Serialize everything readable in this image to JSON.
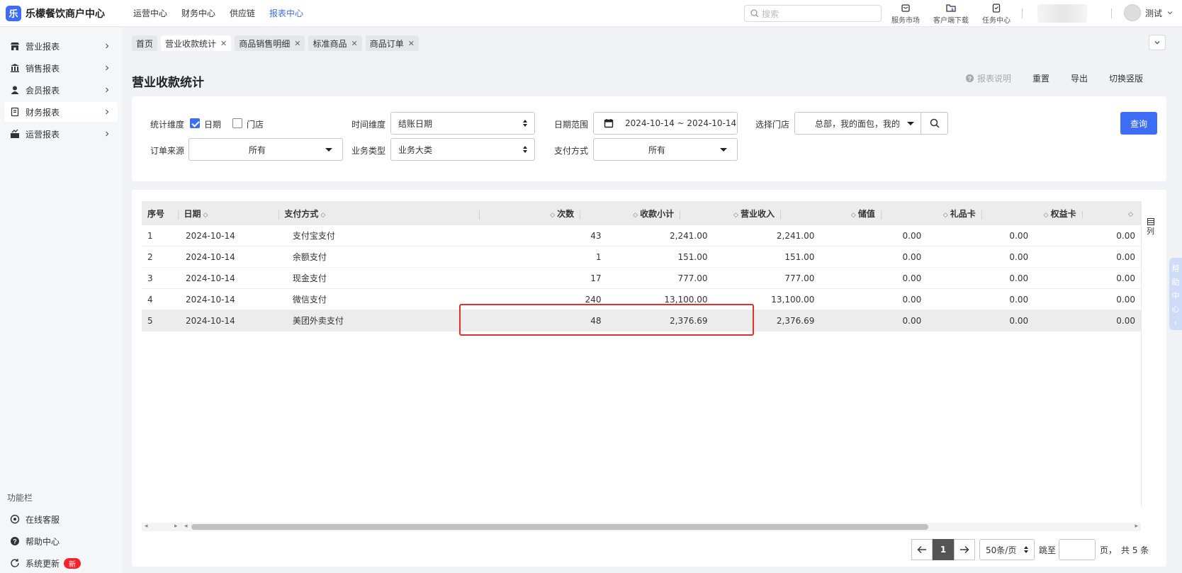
{
  "app": {
    "title": "乐檬餐饮商户中心",
    "logo_glyph": "乐"
  },
  "topnav": [
    {
      "label": "运营中心",
      "active": false
    },
    {
      "label": "财务中心",
      "active": false
    },
    {
      "label": "供应链",
      "active": false
    },
    {
      "label": "报表中心",
      "active": true
    }
  ],
  "search": {
    "placeholder": "搜索"
  },
  "tools": [
    {
      "label": "服务市场",
      "icon": "store-icon"
    },
    {
      "label": "客户端下载",
      "icon": "download-folder-icon"
    },
    {
      "label": "任务中心",
      "icon": "clipboard-icon"
    }
  ],
  "user": {
    "name": "测试"
  },
  "sidebar": {
    "items": [
      {
        "label": "营业报表",
        "icon": "shop-icon"
      },
      {
        "label": "销售报表",
        "icon": "bank-icon"
      },
      {
        "label": "会员报表",
        "icon": "user-icon"
      },
      {
        "label": "财务报表",
        "icon": "receipt-icon",
        "active": true
      },
      {
        "label": "运营报表",
        "icon": "chart-icon"
      }
    ],
    "section_label": "功能栏",
    "bottom": [
      {
        "label": "在线客服",
        "icon": "headset-icon"
      },
      {
        "label": "帮助中心",
        "icon": "help-icon"
      },
      {
        "label": "系统更新",
        "icon": "refresh-icon",
        "badge": "新"
      }
    ]
  },
  "tabs": [
    {
      "label": "首页",
      "closable": false
    },
    {
      "label": "营业收款统计",
      "closable": true,
      "active": true
    },
    {
      "label": "商品销售明细",
      "closable": true
    },
    {
      "label": "标准商品",
      "closable": true
    },
    {
      "label": "商品订单",
      "closable": true
    }
  ],
  "page": {
    "title": "营业收款统计",
    "actions": {
      "help": "报表说明",
      "reset": "重置",
      "export": "导出",
      "switch": "切换竖版"
    }
  },
  "filters": {
    "dimension_label": "统计维度",
    "dim_date": "日期",
    "dim_store": "门店",
    "time_dim_label": "时间维度",
    "time_dim_value": "结账日期",
    "date_range_label": "日期范围",
    "date_range_value": "2024-10-14 ~ 2024-10-14",
    "store_label": "选择门店",
    "store_value": "总部，我的面包，我的",
    "order_source_label": "订单来源",
    "order_source_value": "所有",
    "biz_type_label": "业务类型",
    "biz_type_value": "业务大类",
    "pay_method_label": "支付方式",
    "pay_method_value": "所有",
    "query_label": "查询"
  },
  "table": {
    "headers": [
      "序号",
      "日期",
      "支付方式",
      "",
      "次数",
      "收款小计",
      "营业收入",
      "储值",
      "礼品卡",
      "权益卡"
    ],
    "rows": [
      [
        "1",
        "2024-10-14",
        "支付宝支付",
        "",
        "43",
        "2,241.00",
        "2,241.00",
        "0.00",
        "0.00",
        "0.00"
      ],
      [
        "2",
        "2024-10-14",
        "余额支付",
        "",
        "1",
        "151.00",
        "151.00",
        "0.00",
        "0.00",
        "0.00"
      ],
      [
        "3",
        "2024-10-14",
        "现金支付",
        "",
        "17",
        "777.00",
        "777.00",
        "0.00",
        "0.00",
        "0.00"
      ],
      [
        "4",
        "2024-10-14",
        "微信支付",
        "",
        "240",
        "13,100.00",
        "13,100.00",
        "0.00",
        "0.00",
        "0.00"
      ],
      [
        "5",
        "2024-10-14",
        "美团外卖支付",
        "",
        "48",
        "2,376.69",
        "2,376.69",
        "0.00",
        "0.00",
        "0.00"
      ]
    ],
    "column_toggle": "列"
  },
  "pagination": {
    "current": "1",
    "page_size": "50条/页",
    "jump_label": "跳至",
    "page_unit": "页，",
    "total": "共 5 条"
  },
  "help_float": [
    "帮",
    "助",
    "中",
    "心"
  ],
  "colors": {
    "accent": "#3d6df5",
    "highlight_border": "#e0312e",
    "badge": "#f5222d"
  }
}
